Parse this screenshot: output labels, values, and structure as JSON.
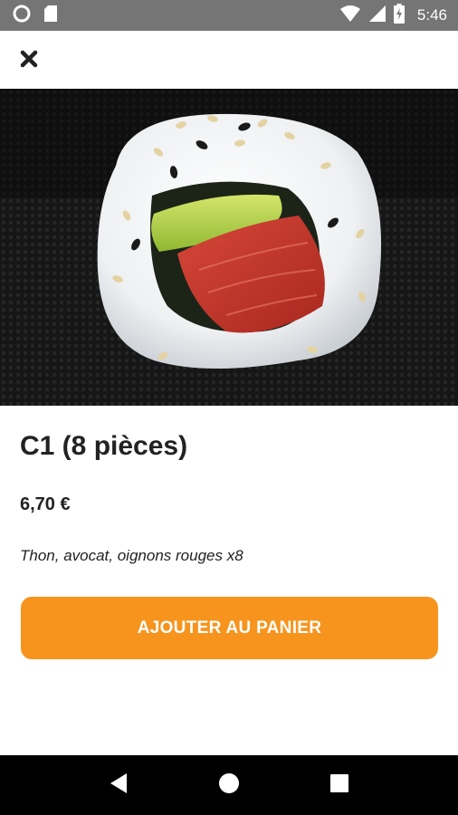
{
  "status_bar": {
    "time": "5:46",
    "icons": [
      "circle-icon",
      "sd-card-icon",
      "wifi-icon",
      "signal-icon",
      "battery-charging-icon"
    ]
  },
  "app_bar": {
    "close_icon": "close-icon"
  },
  "product": {
    "title": "C1 (8 pièces)",
    "price": "6,70 €",
    "description": "Thon, avocat, oignons rouges x8",
    "add_button_label": "AJOUTER AU PANIER"
  },
  "nav_bar": {
    "icons": [
      "back-icon",
      "home-icon",
      "recents-icon"
    ]
  },
  "colors": {
    "accent": "#f7941d",
    "status_bar": "#757575",
    "nav_bar": "#000000",
    "text": "#222222"
  }
}
